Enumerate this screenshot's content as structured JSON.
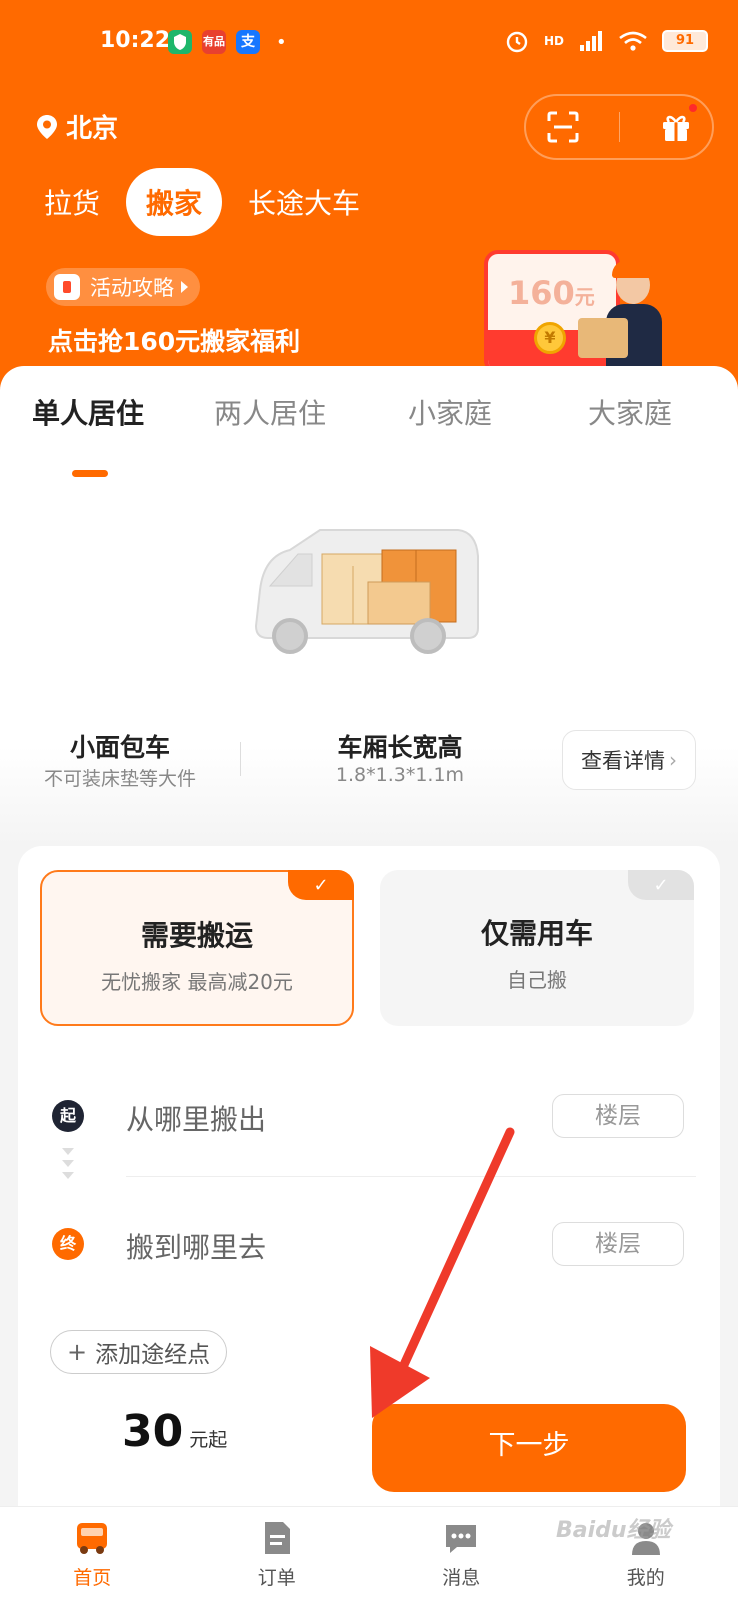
{
  "statusbar": {
    "time": "10:22",
    "apps": [
      "shield-app",
      "youpin-app",
      "alipay-app"
    ],
    "app_labels": [
      "",
      "有品",
      "支"
    ],
    "network": "HD",
    "battery": "91"
  },
  "header": {
    "city": "北京",
    "service_tabs": [
      {
        "label": "拉货",
        "active": false
      },
      {
        "label": "搬家",
        "active": true
      },
      {
        "label": "长途大车",
        "active": false
      }
    ],
    "promo": {
      "pill_label": "活动攻略",
      "headline": "点击抢160元搬家福利",
      "redpack_amount": "160",
      "redpack_unit": "元",
      "coin_symbol": "¥"
    }
  },
  "house_tabs": [
    {
      "label": "单人居住",
      "active": true
    },
    {
      "label": "两人居住",
      "active": false
    },
    {
      "label": "小家庭",
      "active": false
    },
    {
      "label": "大家庭",
      "active": false
    }
  ],
  "vehicle": {
    "name": "小面包车",
    "note": "不可装床垫等大件",
    "dims_title": "车厢长宽高",
    "dims_value": "1.8*1.3*1.1m",
    "details_label": "查看详情"
  },
  "options": [
    {
      "title": "需要搬运",
      "subtitle": "无忧搬家 最高减20元",
      "selected": true
    },
    {
      "title": "仅需用车",
      "subtitle": "自己搬",
      "selected": false
    }
  ],
  "address": {
    "from_badge": "起",
    "from_placeholder": "从哪里搬出",
    "to_badge": "终",
    "to_placeholder": "搬到哪里去",
    "floor_label": "楼层",
    "add_waypoint": "添加途经点"
  },
  "pricing": {
    "amount": "30",
    "unit": "元起",
    "next_label": "下一步"
  },
  "tabbar": [
    {
      "label": "首页",
      "icon": "truck-icon",
      "active": true
    },
    {
      "label": "订单",
      "icon": "document-icon",
      "active": false
    },
    {
      "label": "消息",
      "icon": "chat-icon",
      "active": false
    },
    {
      "label": "我的",
      "icon": "user-icon",
      "active": false
    }
  ],
  "watermark": "Baidu经验",
  "colors": {
    "brand": "#ff6a00",
    "accent_red": "#ff3b2f",
    "badge_dark": "#1f2433",
    "annotation_red": "#ef3a2a"
  }
}
